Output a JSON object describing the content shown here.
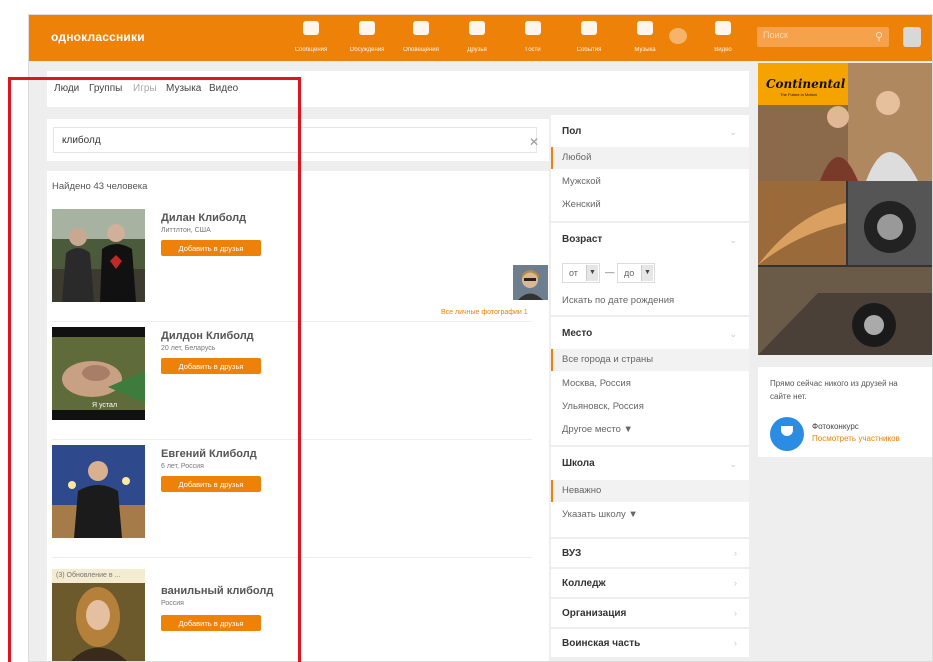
{
  "colors": {
    "brand": "#ee8208",
    "annotation": "#e0141b",
    "link": "#ee8208"
  },
  "topbar": {
    "logo": "одноклассники",
    "nav": [
      {
        "icon": "envelope-icon",
        "label": "Сообщения"
      },
      {
        "icon": "chat-icon",
        "label": "Обсуждения"
      },
      {
        "icon": "bell-icon",
        "label": "Оповещения"
      },
      {
        "icon": "friends-icon",
        "label": "Друзья"
      },
      {
        "icon": "footprints-icon",
        "label": "Гости"
      },
      {
        "icon": "events-icon",
        "label": "События"
      },
      {
        "icon": "music-icon",
        "label": "Музыка"
      },
      {
        "icon": "video-icon",
        "label": "Видео"
      }
    ],
    "search_placeholder": "Поиск"
  },
  "tabs": [
    {
      "label": "Люди",
      "state": "active"
    },
    {
      "label": "Группы",
      "state": "normal"
    },
    {
      "label": "Игры",
      "state": "dim"
    },
    {
      "label": "Музыка",
      "state": "normal"
    },
    {
      "label": "Видео",
      "state": "normal"
    }
  ],
  "search": {
    "value": "клиболд"
  },
  "results": {
    "found_text": "Найдено 43 человека",
    "add_button_label": "Добавить в друзья",
    "all_photos_label": "Все личные фотографии 1",
    "people": [
      {
        "name": "Дилан Клиболд",
        "info": "Литтлтон, США"
      },
      {
        "name": "Дилдон Клиболд",
        "info": "20 лет, Беларусь"
      },
      {
        "name": "Евгений Клиболд",
        "info": "6 лет, Россия"
      },
      {
        "name": "ванильный клиболд",
        "info": "Россия",
        "badge": "(3) Обновление в ..."
      }
    ]
  },
  "filters": {
    "gender": {
      "title": "Пол",
      "options": [
        "Любой",
        "Мужской",
        "Женский"
      ],
      "selected": "Любой"
    },
    "age": {
      "title": "Возраст",
      "from": "от",
      "dash": "—",
      "to": "до",
      "birth_link": "Искать по дате рождения"
    },
    "place": {
      "title": "Место",
      "options": [
        "Все города и страны",
        "Москва, Россия",
        "Ульяновск, Россия",
        "Другое место ▼"
      ],
      "selected": "Все города и страны"
    },
    "school": {
      "title": "Школа",
      "options": [
        "Неважно",
        "Указать школу ▼"
      ],
      "selected": "Неважно"
    },
    "collapsed": [
      "ВУЗ",
      "Колледж",
      "Организация",
      "Воинская часть"
    ]
  },
  "ad": {
    "brand": "Continental",
    "tagline": "The Future in Motion"
  },
  "friends_panel": {
    "text": "Прямо сейчас никого из друзей на сайте нет.",
    "contest_title": "Фотоконкурс",
    "contest_link": "Посмотреть участников"
  }
}
